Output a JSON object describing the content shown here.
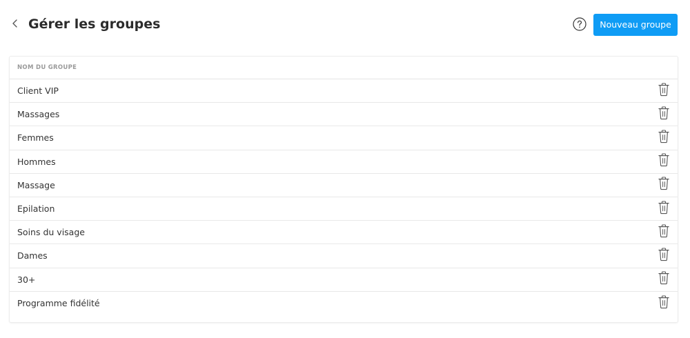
{
  "header": {
    "title": "Gérer les groupes",
    "back_icon": "chevron-left-icon",
    "help_icon": "question-circle-icon",
    "primary_button_label": "Nouveau groupe",
    "primary_color": "#0f9cf5"
  },
  "table": {
    "column_header": "NOM DU GROUPE",
    "row_action_icon": "trash-icon",
    "rows": [
      {
        "name": "Client VIP"
      },
      {
        "name": "Massages"
      },
      {
        "name": "Femmes"
      },
      {
        "name": "Hommes"
      },
      {
        "name": "Massage"
      },
      {
        "name": "Epilation"
      },
      {
        "name": "Soins du visage"
      },
      {
        "name": "Dames"
      },
      {
        "name": "30+"
      },
      {
        "name": "Programme fidélité"
      }
    ]
  }
}
